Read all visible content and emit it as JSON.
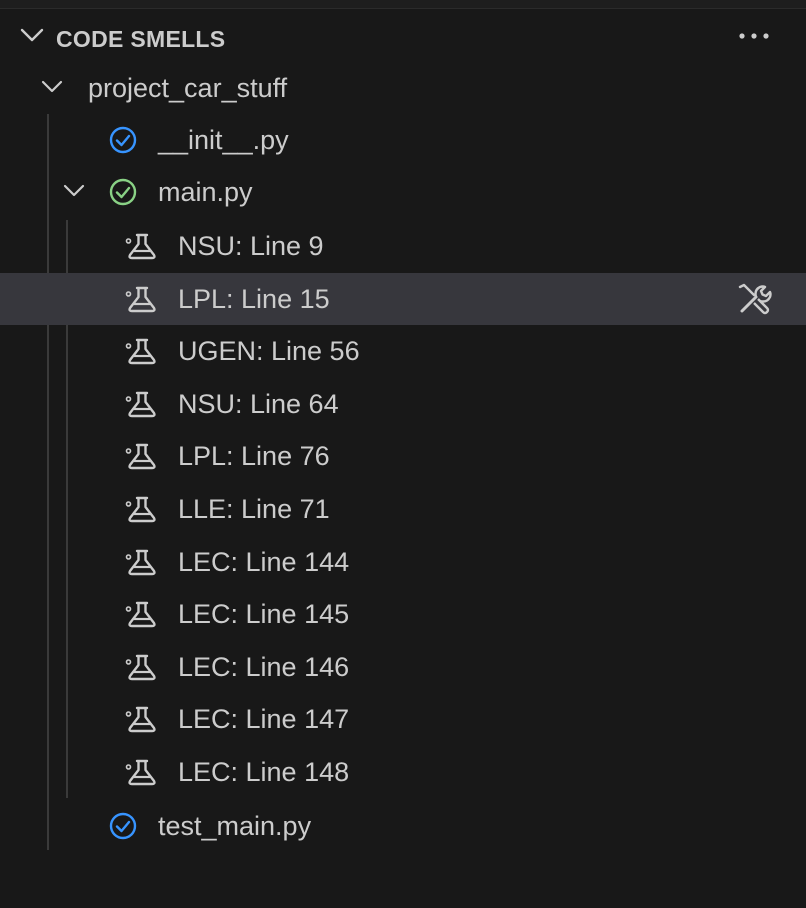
{
  "panel": {
    "title": "CODE SMELLS",
    "more_label": "···"
  },
  "tree": {
    "folder": {
      "label": "project_car_stuff",
      "expanded": true
    },
    "files": [
      {
        "label": "__init__.py",
        "status": "clean",
        "status_color": "#3794ff"
      },
      {
        "label": "main.py",
        "status": "checked",
        "status_color": "#89d185",
        "expanded": true
      },
      {
        "label": "test_main.py",
        "status": "clean",
        "status_color": "#3794ff"
      }
    ],
    "smells": [
      {
        "label": "NSU: Line 9"
      },
      {
        "label": "LPL: Line 15",
        "selected": true
      },
      {
        "label": "UGEN: Line 56"
      },
      {
        "label": "NSU: Line 64"
      },
      {
        "label": "LPL: Line 76"
      },
      {
        "label": "LLE: Line 71"
      },
      {
        "label": "LEC: Line 144"
      },
      {
        "label": "LEC: Line 145"
      },
      {
        "label": "LEC: Line 146"
      },
      {
        "label": "LEC: Line 147"
      },
      {
        "label": "LEC: Line 148"
      }
    ]
  },
  "icons": {
    "section_toggle": "chevron-down-icon",
    "more": "ellipsis-icon",
    "file_status": "check-circle-icon",
    "smell": "smell-icon",
    "fix": "wrench-screwdriver-icon"
  },
  "colors": {
    "background": "#181818",
    "selection": "#37373d",
    "text": "#cccccc",
    "blue_check": "#3794ff",
    "green_check": "#89d185"
  }
}
